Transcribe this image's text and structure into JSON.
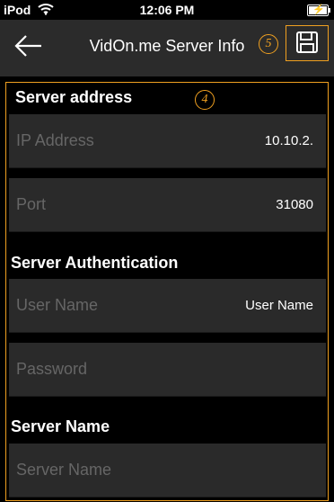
{
  "status_bar": {
    "carrier": "iPod",
    "time": "12:06 PM",
    "wifi_icon": "wifi-icon",
    "battery_icon": "battery-charging-icon"
  },
  "header": {
    "title": "VidOn.me Server Info",
    "back_icon": "back-arrow-icon",
    "save_icon": "floppy-disk-icon",
    "callout_5": "5",
    "accent_color": "#f0a020"
  },
  "callout_4": "4",
  "sections": {
    "server_address": {
      "title": "Server address",
      "ip_label": "IP Address",
      "ip_value": "10.10.2.",
      "port_label": "Port",
      "port_value": "31080"
    },
    "server_authentication": {
      "title": "Server Authentication",
      "username_label": "User Name",
      "username_value": "User Name",
      "password_label": "Password"
    },
    "server_name": {
      "title": "Server Name",
      "name_label": "Server Name"
    }
  },
  "colors": {
    "background": "#000000",
    "nav_bar": "#2b2b2b",
    "row_background": "#2a2a2a",
    "label_gray": "#666666",
    "accent": "#f0a020"
  }
}
